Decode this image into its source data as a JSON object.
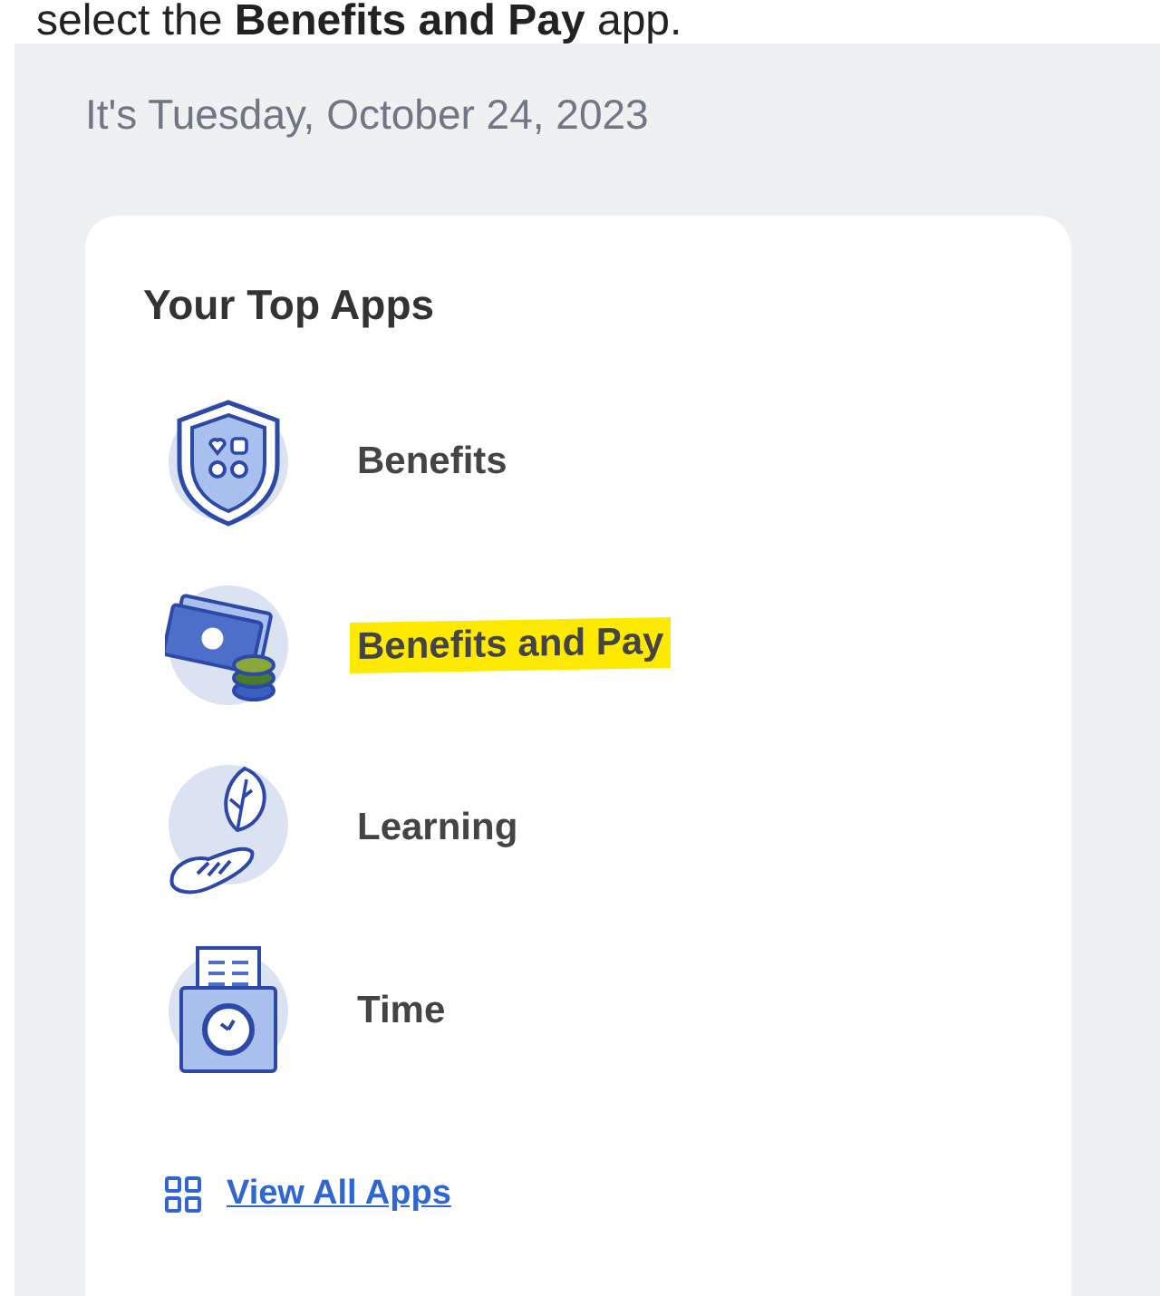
{
  "instruction": "select the **Benefits and Pay** app.",
  "date_line": "It's Tuesday, October 24, 2023",
  "card": {
    "title": "Your Top Apps",
    "apps": [
      {
        "kind": "shield",
        "label": "Benefits",
        "highlighted": false
      },
      {
        "kind": "money",
        "label": "Benefits and Pay",
        "highlighted": true
      },
      {
        "kind": "leaf",
        "label": "Learning",
        "highlighted": false
      },
      {
        "kind": "clock",
        "label": "Time",
        "highlighted": false
      }
    ],
    "view_all": "View All Apps"
  }
}
